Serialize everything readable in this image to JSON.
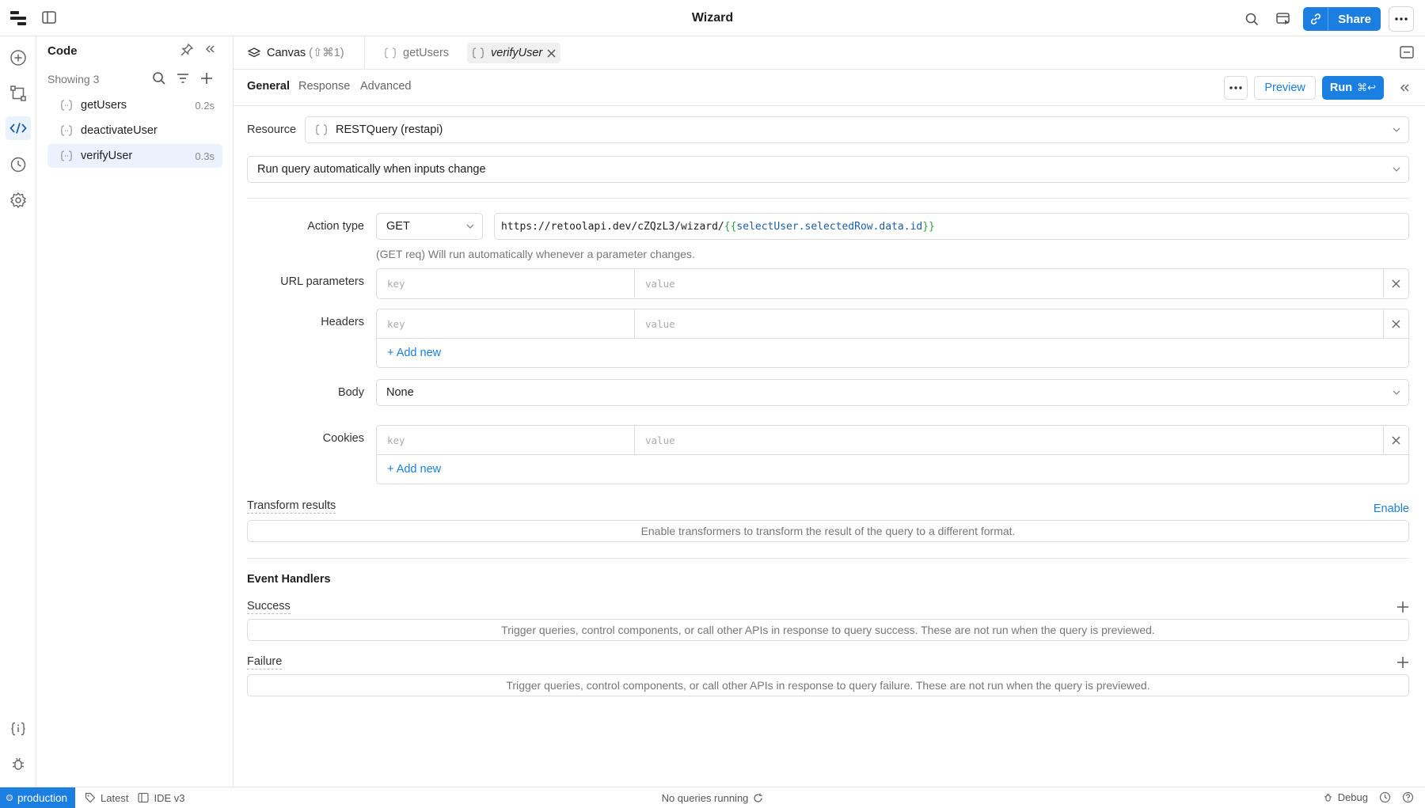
{
  "app": {
    "title": "Wizard"
  },
  "topbar": {
    "share_label": "Share"
  },
  "code_panel": {
    "title": "Code",
    "showing": "Showing 3",
    "queries": [
      {
        "name": "getUsers",
        "time": "0.2s"
      },
      {
        "name": "deactivateUser",
        "time": ""
      },
      {
        "name": "verifyUser",
        "time": "0.3s"
      }
    ]
  },
  "tabs": {
    "canvas": "Canvas",
    "canvas_hint": "(⇧⌘1)",
    "get_users": "getUsers",
    "verify_user": "verifyUser"
  },
  "subtabs": [
    "General",
    "Response",
    "Advanced"
  ],
  "actions": {
    "preview": "Preview",
    "run": "Run",
    "run_kbd": "⌘↩"
  },
  "general": {
    "resource_label": "Resource",
    "resource_value": "RESTQuery (restapi)",
    "run_mode": "Run query automatically when inputs change",
    "action_type_label": "Action type",
    "action_type_value": "GET",
    "url_prefix": "https://retoolapi.dev/cZQzL3/wizard/",
    "url_tpl_open": "{{ ",
    "url_tpl_var": "selectUser.selectedRow.data.id",
    "url_tpl_close": " }}",
    "url_hint": "(GET req) Will run automatically whenever a parameter changes.",
    "url_params_label": "URL parameters",
    "headers_label": "Headers",
    "body_label": "Body",
    "body_value": "None",
    "cookies_label": "Cookies",
    "key_placeholder": "key",
    "value_placeholder": "value",
    "add_new": "+ Add new"
  },
  "transform": {
    "label": "Transform results",
    "enable": "Enable",
    "message": "Enable transformers to transform the result of the query to a different format."
  },
  "events": {
    "title": "Event Handlers",
    "success_label": "Success",
    "success_message": "Trigger queries, control components, or call other APIs in response to query success. These are not run when the query is previewed.",
    "failure_label": "Failure",
    "failure_message": "Trigger queries, control components, or call other APIs in response to query failure. These are not run when the query is previewed."
  },
  "statusbar": {
    "env": "production",
    "version": "Latest",
    "ide": "IDE v3",
    "center": "No queries running",
    "debug": "Debug"
  },
  "colors": {
    "accent": "#1a7fe0",
    "template_brace": "#2f9e44",
    "template_var": "#1c5fa8"
  }
}
